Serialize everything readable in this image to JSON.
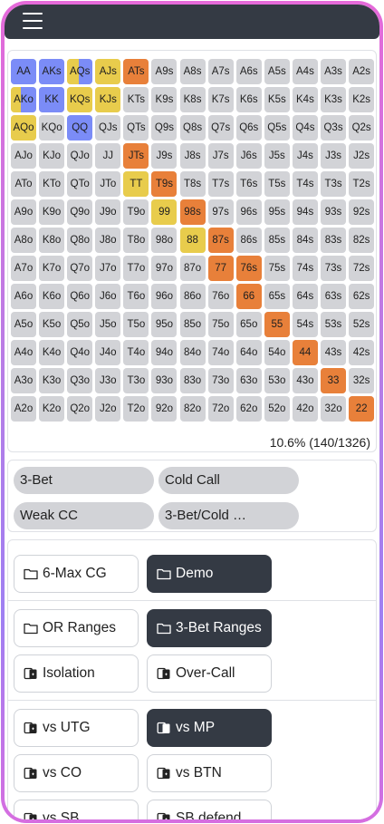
{
  "menu": {
    "icon": "hamburger-menu-icon"
  },
  "colors": {
    "cell_default": "#d2d3d7",
    "three_bet": "#7b8cf7",
    "cold_call": "#e8cc4c",
    "weak_cc": "#e8803a",
    "dark_button": "#343a44"
  },
  "grid": {
    "ranks": [
      "A",
      "K",
      "Q",
      "J",
      "T",
      "9",
      "8",
      "7",
      "6",
      "5",
      "4",
      "3",
      "2"
    ],
    "highlights": {
      "AA": [
        [
          "three_bet",
          100
        ]
      ],
      "AKs": [
        [
          "three_bet",
          100
        ]
      ],
      "AQs": [
        [
          "cold_call",
          45
        ],
        [
          "three_bet",
          55
        ]
      ],
      "AJs": [
        [
          "cold_call",
          100
        ]
      ],
      "ATs": [
        [
          "weak_cc",
          100
        ]
      ],
      "AKo": [
        [
          "cold_call",
          40
        ],
        [
          "three_bet",
          60
        ]
      ],
      "KK": [
        [
          "three_bet",
          100
        ]
      ],
      "KQs": [
        [
          "cold_call",
          100
        ]
      ],
      "KJs": [
        [
          "cold_call",
          100
        ]
      ],
      "AQo": [
        [
          "cold_call",
          100
        ]
      ],
      "QQ": [
        [
          "three_bet",
          100
        ]
      ],
      "JTs": [
        [
          "weak_cc",
          100
        ]
      ],
      "TT": [
        [
          "cold_call",
          100
        ]
      ],
      "T9s": [
        [
          "weak_cc",
          100
        ]
      ],
      "99": [
        [
          "cold_call",
          100
        ]
      ],
      "98s": [
        [
          "weak_cc",
          100
        ]
      ],
      "88": [
        [
          "cold_call",
          100
        ]
      ],
      "87s": [
        [
          "weak_cc",
          100
        ]
      ],
      "77": [
        [
          "weak_cc",
          100
        ]
      ],
      "76s": [
        [
          "weak_cc",
          100
        ]
      ],
      "66": [
        [
          "weak_cc",
          100
        ]
      ],
      "55": [
        [
          "weak_cc",
          100
        ]
      ],
      "44": [
        [
          "weak_cc",
          100
        ]
      ],
      "33": [
        [
          "weak_cc",
          100
        ]
      ],
      "22": [
        [
          "weak_cc",
          100
        ]
      ]
    },
    "summary": "10.6% (140/1326)"
  },
  "legend": [
    {
      "label": "3-Bet",
      "segments": [
        [
          "three_bet",
          100
        ]
      ]
    },
    {
      "label": "Cold Call",
      "segments": [
        [
          "cold_call",
          100
        ]
      ]
    },
    {
      "label": "Weak CC",
      "segments": [
        [
          "weak_cc",
          100
        ]
      ]
    },
    {
      "label": "3-Bet/Cold …",
      "segments": [
        [
          "cold_call",
          40
        ],
        [
          "three_bet",
          60
        ]
      ]
    }
  ],
  "nav": {
    "folders": [
      {
        "label": "6-Max CG",
        "icon": "folder-icon",
        "active": false
      },
      {
        "label": "Demo",
        "icon": "folder-icon",
        "active": true
      },
      {
        "label": "OR Ranges",
        "icon": "folder-icon",
        "active": false
      },
      {
        "label": "3-Bet Ranges",
        "icon": "folder-icon",
        "active": true
      }
    ],
    "ranges": [
      {
        "label": "Isolation",
        "icon": "cards-icon",
        "active": false
      },
      {
        "label": "Over-Call",
        "icon": "cards-icon",
        "active": false
      },
      {
        "label": "vs UTG",
        "icon": "cards-icon",
        "active": false
      },
      {
        "label": "vs MP",
        "icon": "cards-icon",
        "active": true
      },
      {
        "label": "vs CO",
        "icon": "cards-icon",
        "active": false
      },
      {
        "label": "vs BTN",
        "icon": "cards-icon",
        "active": false
      },
      {
        "label": "vs SB",
        "icon": "cards-icon",
        "active": false
      },
      {
        "label": "SB defend",
        "icon": "cards-icon",
        "active": false
      }
    ]
  }
}
